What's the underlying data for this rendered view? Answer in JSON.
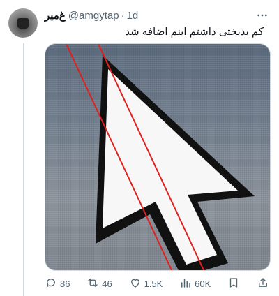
{
  "author": {
    "display_name": "غ‌میر",
    "handle": "@amgytap",
    "time": "1d"
  },
  "tweet": {
    "text": "کم بدبختی داشتم اینم اضافه شد"
  },
  "media": {
    "description_icon": "mouse-cursor-arrow-photo"
  },
  "actions": {
    "replies": "86",
    "reposts": "46",
    "likes": "1.5K",
    "views": "60K"
  },
  "colors": {
    "text": "#0f1419",
    "secondary": "#536471",
    "divider": "#cfd9de",
    "red_line": "#e0201e"
  }
}
